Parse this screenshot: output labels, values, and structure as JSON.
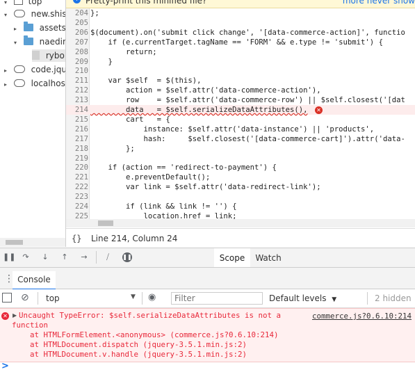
{
  "file_tree": {
    "items": [
      {
        "label": "top",
        "type": "frame"
      },
      {
        "label": "new.shish",
        "type": "cloud"
      },
      {
        "label": "assets",
        "type": "folder"
      },
      {
        "label": "naedine",
        "type": "folder"
      },
      {
        "label": "rybol",
        "type": "file"
      },
      {
        "label": "code.jque",
        "type": "cloud"
      },
      {
        "label": "localhost",
        "type": "cloud"
      }
    ]
  },
  "infobar": {
    "text": "Pretty-print this minified file?",
    "links": "more  never show"
  },
  "editor": {
    "lines": [
      {
        "n": "204",
        "code": "};"
      },
      {
        "n": "205",
        "code": ""
      },
      {
        "n": "206",
        "code": "$(document).on('submit click change', '[data-commerce-action]', functio"
      },
      {
        "n": "207",
        "code": "    if (e.currentTarget.tagName == 'FORM' && e.type != 'submit') {"
      },
      {
        "n": "208",
        "code": "        return;"
      },
      {
        "n": "209",
        "code": "    }"
      },
      {
        "n": "210",
        "code": ""
      },
      {
        "n": "211",
        "code": "    var $self  = $(this),"
      },
      {
        "n": "212",
        "code": "        action = $self.attr('data-commerce-action'),"
      },
      {
        "n": "213",
        "code": "        row    = $self.attr('data-commerce-row') || $self.closest('[dat"
      },
      {
        "n": "214",
        "code": "        data   = $self.serializeDataAttributes(),"
      },
      {
        "n": "215",
        "code": "        cart   = {"
      },
      {
        "n": "216",
        "code": "            instance: $self.attr('data-instance') || 'products',"
      },
      {
        "n": "217",
        "code": "            hash:     $self.closest('[data-commerce-cart]').attr('data-"
      },
      {
        "n": "218",
        "code": "        };"
      },
      {
        "n": "219",
        "code": ""
      },
      {
        "n": "220",
        "code": "    if (action == 'redirect-to-payment') {"
      },
      {
        "n": "221",
        "code": "        e.preventDefault();"
      },
      {
        "n": "222",
        "code": "        var link = $self.attr('data-redirect-link');"
      },
      {
        "n": "223",
        "code": ""
      },
      {
        "n": "224",
        "code": "        if (link && link != '') {"
      },
      {
        "n": "225",
        "code": "            location.href = link;"
      },
      {
        "n": "226",
        "code": ""
      }
    ],
    "highlight_line": "214"
  },
  "statusbar": {
    "braces": "{}",
    "cursor": "Line 214, Column 24"
  },
  "debugger": {
    "tabs": [
      {
        "label": "Scope"
      },
      {
        "label": "Watch"
      }
    ]
  },
  "drawer": {
    "tab": "Console",
    "context": "top",
    "filter_placeholder": "Filter",
    "levels": "Default levels",
    "hidden": "2 hidden"
  },
  "console_error": {
    "lines": [
      "Uncaught TypeError: $self.serializeDataAttributes is not a",
      "function",
      "    at HTMLFormElement.<anonymous> (commerce.js?0.6.10:214)",
      "    at HTMLDocument.dispatch (jquery-3.5.1.min.js:2)",
      "    at HTMLDocument.v.handle (jquery-3.5.1.min.js:2)"
    ],
    "source": "commerce.js?0.6.10:214"
  },
  "prompt": ">",
  "colors": {
    "error": "#e8283a",
    "accent": "#1a73e8",
    "folder": "#5a9fd4"
  },
  "icons": [
    "info-icon",
    "folder-icon",
    "cloud-icon",
    "file-icon",
    "error-icon",
    "pause-icon",
    "step-over-icon",
    "step-into-icon",
    "step-out-icon",
    "step-icon",
    "deactivate-breakpoints-icon",
    "pause-on-exceptions-icon",
    "kebab-icon",
    "sidebar-toggle-icon",
    "clear-console-icon",
    "eye-icon"
  ]
}
